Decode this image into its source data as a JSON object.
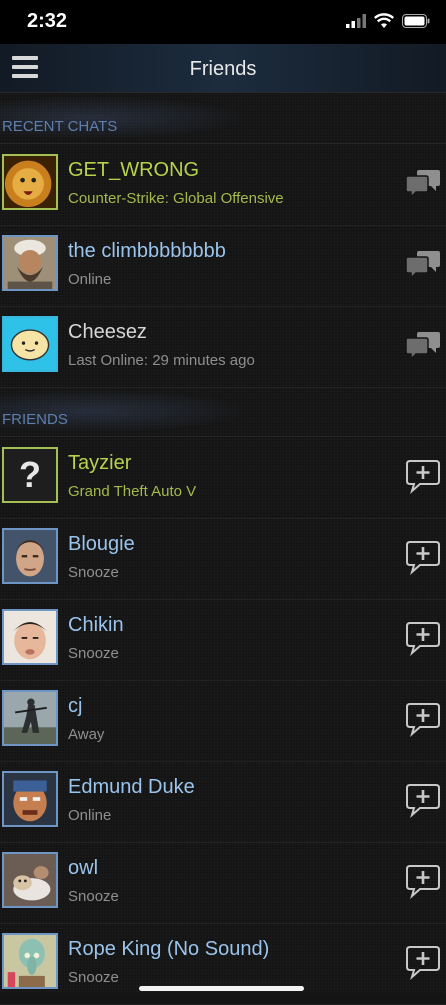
{
  "status_bar": {
    "time": "2:32",
    "icons": [
      "cellular-icon",
      "wifi-icon",
      "battery-icon"
    ]
  },
  "nav": {
    "title": "Friends"
  },
  "recent_chats": {
    "header": "RECENT CHATS",
    "items": [
      {
        "name": "GET_WRONG",
        "status": "Counter-Strike: Global Offensive",
        "state": "ingame"
      },
      {
        "name": "the climbbbbbbbb",
        "status": "Online",
        "state": "online"
      },
      {
        "name": "Cheesez",
        "status": "Last Online: 29 minutes ago",
        "state": "offline"
      }
    ]
  },
  "friends": {
    "header": "FRIENDS",
    "items": [
      {
        "name": "Tayzier",
        "status": "Grand Theft Auto V",
        "state": "ingame",
        "avatar_text": "?"
      },
      {
        "name": "Blougie",
        "status": "Snooze",
        "state": "snooze"
      },
      {
        "name": "Chikin",
        "status": "Snooze",
        "state": "snooze"
      },
      {
        "name": "cj",
        "status": "Away",
        "state": "away"
      },
      {
        "name": "Edmund Duke",
        "status": "Online",
        "state": "online"
      },
      {
        "name": "owl",
        "status": "Snooze",
        "state": "snooze"
      },
      {
        "name": "Rope King (No Sound)",
        "status": "Snooze",
        "state": "snooze"
      }
    ]
  },
  "colors": {
    "ingame": "#b7d24c",
    "online": "#9ac4ec",
    "offline": "#d6d6d6",
    "section_header": "#5e7fae"
  }
}
